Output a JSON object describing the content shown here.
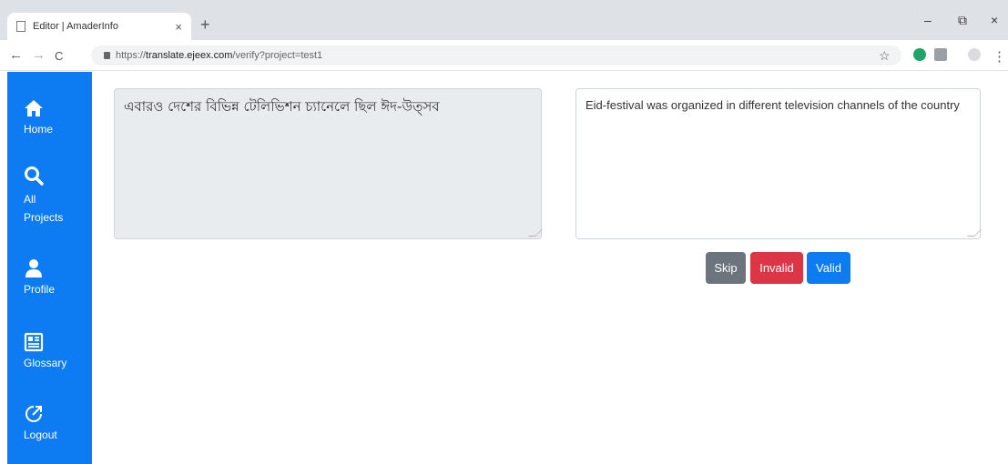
{
  "browser": {
    "tab_title": "Editor | AmaderInfo",
    "tab_close": "×",
    "new_tab": "+",
    "url_scheme": "https://",
    "url_host": "translate.ejeex.com",
    "url_path": "/verify?project=test1",
    "nav_back": "←",
    "nav_forward": "→",
    "nav_reload": "C",
    "bookmark_star": "☆",
    "menu_dots": "⋮",
    "win_minimize": "–",
    "win_restore": "⧉",
    "win_close": "×"
  },
  "sidebar": {
    "items": [
      {
        "label": "Home",
        "icon": "home-icon"
      },
      {
        "label": "All Projects",
        "icon": "search-icon"
      },
      {
        "label": "Profile",
        "icon": "user-icon"
      },
      {
        "label": "Glossary",
        "icon": "newspaper-icon"
      },
      {
        "label": "Logout",
        "icon": "external-link-icon"
      }
    ]
  },
  "editor": {
    "source_text": "এবারও দেশের বিভিন্ন টেলিভিশন চ্যানেলে ছিল ঈদ-উত্সব",
    "translation_text": "Eid-festival was organized in different television channels of the country"
  },
  "actions": {
    "skip_label": "Skip",
    "invalid_label": "Invalid",
    "valid_label": "Valid"
  },
  "colors": {
    "sidebar": "#0d7cf2",
    "skip": "#6c757d",
    "invalid": "#dc3545",
    "valid": "#0d7cf2"
  }
}
